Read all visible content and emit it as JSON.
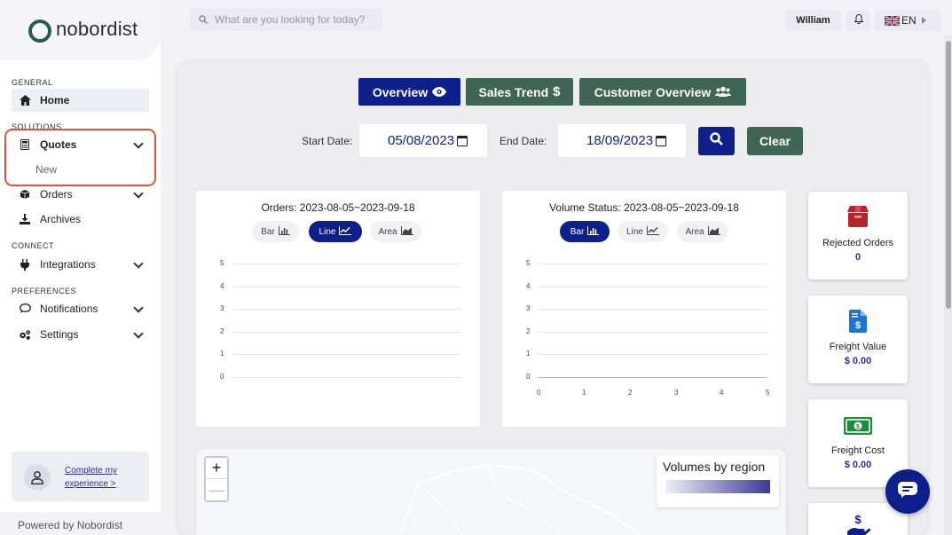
{
  "brand": {
    "name": "nobordist"
  },
  "sidebar": {
    "sections": {
      "general": "GENERAL",
      "solutions": "SOLUTIONS",
      "connect": "CONNECT",
      "preferences": "PREFERENCES"
    },
    "items": [
      {
        "label": "Home",
        "icon": "home-icon"
      },
      {
        "label": "Quotes",
        "icon": "calculator-icon"
      },
      {
        "label": "Orders",
        "icon": "box-icon"
      },
      {
        "label": "Archives",
        "icon": "download-icon"
      },
      {
        "label": "Integrations",
        "icon": "plug-icon"
      },
      {
        "label": "Notifications",
        "icon": "chat-icon"
      },
      {
        "label": "Settings",
        "icon": "gears-icon"
      }
    ],
    "quotes_sub": "New",
    "profile_link": "Complete my experience >",
    "footer": "Powered by Nobordist"
  },
  "topbar": {
    "search_placeholder": "What are you looking for today?",
    "user": "William",
    "language": "EN"
  },
  "tabs": {
    "overview": "Overview",
    "sales": "Sales Trend",
    "customer": "Customer Overview"
  },
  "filters": {
    "start_label": "Start Date:",
    "start_value": "05/08/2023",
    "end_label": "End Date:",
    "end_value": "18/09/2023",
    "clear": "Clear"
  },
  "charts": {
    "toggle_bar": "Bar",
    "toggle_line": "Line",
    "toggle_area": "Area",
    "orders_title": "Orders: 2023-08-05~2023-09-18",
    "volume_title": "Volume Status: 2023-08-05~2023-09-18"
  },
  "chart_data": [
    {
      "type": "line",
      "title": "Orders: 2023-08-05~2023-09-18",
      "y_ticks": [
        "5",
        "4",
        "3",
        "2",
        "1",
        "0"
      ],
      "ylim": [
        0,
        5
      ],
      "series": [],
      "grid": true
    },
    {
      "type": "bar",
      "title": "Volume Status: 2023-08-05~2023-09-18",
      "y_ticks": [
        "5",
        "4",
        "3",
        "2",
        "1",
        "0"
      ],
      "x_ticks": [
        "0",
        "1",
        "2",
        "3",
        "4",
        "5"
      ],
      "ylim": [
        0,
        5
      ],
      "xlim": [
        0,
        5
      ],
      "series": [],
      "grid": true
    }
  ],
  "stats": [
    {
      "label": "Rejected Orders",
      "value": "0",
      "icon": "box-icon",
      "color": "#b5262a"
    },
    {
      "label": "Freight Value",
      "value": "$ 0.00",
      "icon": "invoice-dollar-icon",
      "color": "#1f73d6"
    },
    {
      "label": "Freight Cost",
      "value": "$ 0.00",
      "icon": "money-bill-icon",
      "color": "#1e8a3a"
    }
  ],
  "map": {
    "legend_title": "Volumes by region",
    "zoom_in": "+",
    "zoom_out": "—"
  },
  "colors": {
    "primary": "#0c1f8a",
    "secondary": "#3f6555",
    "highlight": "#d9553d"
  }
}
